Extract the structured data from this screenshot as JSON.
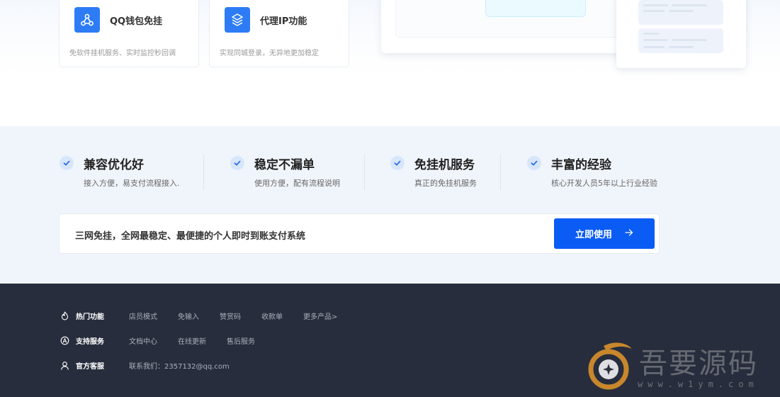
{
  "features_top": [
    {
      "title": "QQ钱包免挂",
      "desc": "免软件挂机服务、实时监控秒回调",
      "icon": "network-icon"
    },
    {
      "title": "代理IP功能",
      "desc": "实现同城登录，无异地更加稳定",
      "icon": "layers-icon"
    }
  ],
  "benefits": [
    {
      "title": "兼容优化好",
      "desc": "接入方便，易支付流程接入."
    },
    {
      "title": "稳定不漏单",
      "desc": "使用方便，配有流程说明"
    },
    {
      "title": "免挂机服务",
      "desc": "真正的免挂机服务"
    },
    {
      "title": "丰富的经验",
      "desc": "核心开发人员5年以上行业经验"
    }
  ],
  "cta": {
    "text": "三网免挂，全网最稳定、最便捷的个人即时到账支付系统",
    "button": "立即使用"
  },
  "footer": {
    "hot": {
      "heading": "热门功能",
      "links": [
        "店员模式",
        "免输入",
        "赞赏码",
        "收款单",
        "更多产品>"
      ]
    },
    "support": {
      "heading": "支持服务",
      "links": [
        "文档中心",
        "在线更新",
        "售后服务"
      ]
    },
    "service": {
      "heading": "官方客服",
      "contact": "联系我们：2357132@qq.com"
    }
  },
  "watermark": {
    "text": "吾要源码",
    "url": "www.w1ym.com"
  },
  "colors": {
    "primary": "#0a5cf5",
    "icon_blue": "#2d7cf6",
    "footer_bg": "#272d3c",
    "band_bg": "#f0f5fb"
  }
}
